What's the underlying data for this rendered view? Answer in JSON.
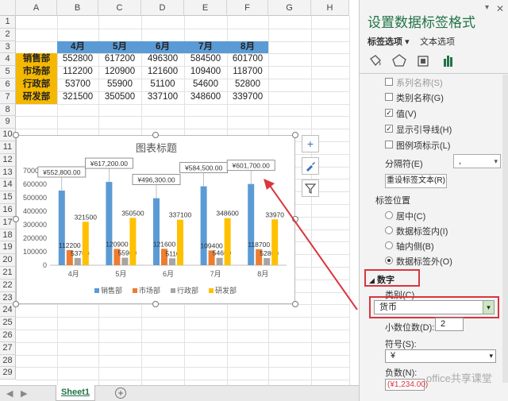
{
  "sheet": {
    "columns": [
      "A",
      "B",
      "C",
      "D",
      "E",
      "F",
      "G",
      "H"
    ],
    "rows": [
      "1",
      "2",
      "3",
      "4",
      "5",
      "6",
      "7",
      "8",
      "9",
      "10",
      "11",
      "12",
      "13",
      "14",
      "15",
      "16",
      "17",
      "18",
      "19",
      "20",
      "21",
      "22",
      "23",
      "24",
      "25",
      "26",
      "27",
      "28",
      "29"
    ],
    "table_header": [
      "4月",
      "5月",
      "6月",
      "7月",
      "8月"
    ],
    "table_rows": [
      {
        "label": "销售部",
        "values": [
          "552800",
          "617200",
          "496300",
          "584500",
          "601700"
        ]
      },
      {
        "label": "市场部",
        "values": [
          "112200",
          "120900",
          "121600",
          "109400",
          "118700"
        ]
      },
      {
        "label": "行政部",
        "values": [
          "53700",
          "55900",
          "51100",
          "54600",
          "52800"
        ]
      },
      {
        "label": "研发部",
        "values": [
          "321500",
          "350500",
          "337100",
          "348600",
          "339700"
        ]
      }
    ],
    "tab_name": "Sheet1",
    "add_sheet": "+"
  },
  "chart_data": {
    "type": "bar",
    "title": "图表标题",
    "categories": [
      "4月",
      "5月",
      "6月",
      "7月",
      "8月"
    ],
    "series": [
      {
        "name": "销售部",
        "color": "#5b9bd5",
        "values": [
          552800,
          617200,
          496300,
          584500,
          601700
        ]
      },
      {
        "name": "市场部",
        "color": "#ed7d31",
        "values": [
          112200,
          120900,
          121600,
          109400,
          118700
        ]
      },
      {
        "name": "行政部",
        "color": "#a5a5a5",
        "values": [
          53700,
          55900,
          51100,
          54600,
          52800
        ]
      },
      {
        "name": "研发部",
        "color": "#ffc000",
        "values": [
          321500,
          350500,
          337100,
          348600,
          339700
        ]
      }
    ],
    "data_labels_sales": [
      "¥552,800.00",
      "¥617,200.00",
      "¥496,300.00",
      "¥584,500.00",
      "¥601,700.00"
    ],
    "data_labels_other": [
      [
        "112200",
        "120900",
        "121600",
        "109400",
        "118700"
      ],
      [
        "53700",
        "55900",
        "51100",
        "54600",
        "52800"
      ],
      [
        "321500",
        "350500",
        "337100",
        "348600",
        "33970"
      ]
    ],
    "y_ticks": [
      "0",
      "100000",
      "200000",
      "300000",
      "400000",
      "500000",
      "600000",
      "700000"
    ],
    "ylim": [
      0,
      700000
    ],
    "legend_position": "bottom",
    "grid": false
  },
  "panel": {
    "title": "设置数据标签格式",
    "tab_label_options": "标签选项",
    "tab_text_options": "文本选项",
    "chk_series_name": "系列名称(S)",
    "chk_category_name": "类别名称(G)",
    "chk_value": "值(V)",
    "chk_leader_lines": "显示引导线(H)",
    "chk_legend_key": "图例项标示(L)",
    "separator_label": "分隔符(E)",
    "separator_value": ",",
    "reset_button": "重设标签文本(R)",
    "position_label": "标签位置",
    "pos_center": "居中(C)",
    "pos_inside_end": "数据标签内(I)",
    "pos_inside_base": "轴内侧(B)",
    "pos_outside_end": "数据标签外(O)",
    "number_section": "数字",
    "category_label": "类别(C)",
    "category_value": "货币",
    "decimals_label": "小数位数(D):",
    "decimals_value": "2",
    "symbol_label": "符号(S):",
    "symbol_value": "¥",
    "negative_label": "负数(N):",
    "negative_value": "(¥1,234.00)",
    "watermark": "office共享课堂"
  },
  "colors": {
    "header_blue": "#5b9bd5",
    "label_gold": "#f5b800",
    "panel_title": "#2e7d32",
    "highlight_red": "#d9363e"
  }
}
